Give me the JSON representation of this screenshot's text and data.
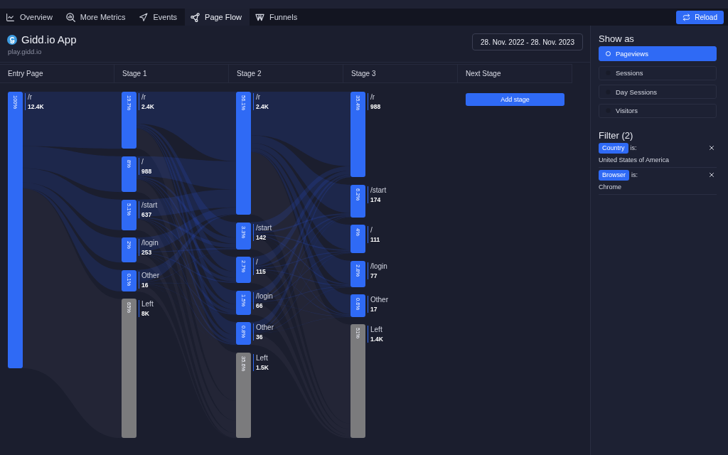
{
  "nav": {
    "tabs": [
      {
        "label": "Overview",
        "selected": false
      },
      {
        "label": "More Metrics",
        "selected": false
      },
      {
        "label": "Events",
        "selected": false
      },
      {
        "label": "Page Flow",
        "selected": true
      },
      {
        "label": "Funnels",
        "selected": false
      }
    ],
    "reload_button": "Reload"
  },
  "app": {
    "name": "Gidd.io App",
    "domain": "play.gidd.io"
  },
  "date_range": "28. Nov. 2022 - 28. Nov. 2023",
  "stages": [
    {
      "title": "Entry Page",
      "nodes": [
        {
          "kind": "page",
          "percent": "100%",
          "label": "/r",
          "count": "12.4K"
        }
      ]
    },
    {
      "title": "Stage 1",
      "nodes": [
        {
          "kind": "page",
          "percent": "19.7%",
          "label": "/r",
          "count": "2.4K"
        },
        {
          "kind": "page",
          "percent": "8%",
          "label": "/",
          "count": "988"
        },
        {
          "kind": "page",
          "percent": "5.1%",
          "label": "/start",
          "count": "637"
        },
        {
          "kind": "page",
          "percent": "2%",
          "label": "/login",
          "count": "253"
        },
        {
          "kind": "page",
          "percent": "0.1%",
          "label": "Other",
          "count": "16"
        },
        {
          "kind": "left",
          "percent": "65%",
          "label": "Left",
          "count": "8K"
        }
      ]
    },
    {
      "title": "Stage 2",
      "nodes": [
        {
          "kind": "page",
          "percent": "56.1%",
          "label": "/r",
          "count": "2.4K"
        },
        {
          "kind": "page",
          "percent": "3.3%",
          "label": "/start",
          "count": "142"
        },
        {
          "kind": "page",
          "percent": "2.7%",
          "label": "/",
          "count": "115"
        },
        {
          "kind": "page",
          "percent": "1.5%",
          "label": "/login",
          "count": "66"
        },
        {
          "kind": "page",
          "percent": "0.8%",
          "label": "Other",
          "count": "36"
        },
        {
          "kind": "left",
          "percent": "35.6%",
          "label": "Left",
          "count": "1.5K"
        }
      ]
    },
    {
      "title": "Stage 3",
      "nodes": [
        {
          "kind": "page",
          "percent": "35.4%",
          "label": "/r",
          "count": "988"
        },
        {
          "kind": "page",
          "percent": "6.2%",
          "label": "/start",
          "count": "174"
        },
        {
          "kind": "page",
          "percent": "4%",
          "label": "/",
          "count": "111"
        },
        {
          "kind": "page",
          "percent": "2.8%",
          "label": "/login",
          "count": "77"
        },
        {
          "kind": "page",
          "percent": "0.6%",
          "label": "Other",
          "count": "17"
        },
        {
          "kind": "left",
          "percent": "51%",
          "label": "Left",
          "count": "1.4K"
        }
      ]
    }
  ],
  "next_stage": {
    "title": "Next Stage",
    "button": "Add stage"
  },
  "sidebar": {
    "show_as": {
      "title": "Show as",
      "options": [
        {
          "label": "Pageviews",
          "selected": true
        },
        {
          "label": "Sessions",
          "selected": false
        },
        {
          "label": "Day Sessions",
          "selected": false
        },
        {
          "label": "Visitors",
          "selected": false
        }
      ]
    },
    "filter": {
      "title": "Filter (2)",
      "items": [
        {
          "field": "Country",
          "operator": "is:",
          "value": "United States of America"
        },
        {
          "field": "Browser",
          "operator": "is:",
          "value": "Chrome"
        }
      ]
    }
  }
}
